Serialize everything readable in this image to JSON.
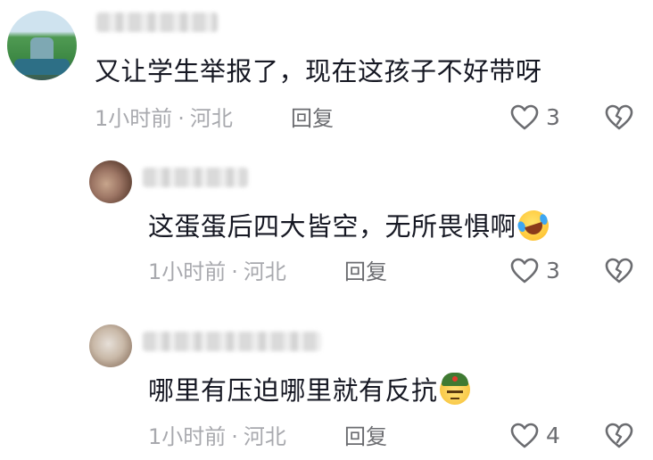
{
  "comments": [
    {
      "text": "又让学生举报了，现在这孩子不好带呀",
      "time": "1小时前",
      "separator": "·",
      "location": "河北",
      "reply_label": "回复",
      "likes": "3"
    },
    {
      "text": "这蛋蛋后四大皆空，无所畏惧啊",
      "emoji": "laughing-tears-emoji",
      "time": "1小时前",
      "separator": "·",
      "location": "河北",
      "reply_label": "回复",
      "likes": "3"
    },
    {
      "text": "哪里有压迫哪里就有反抗",
      "emoji": "soldier-emoji",
      "time": "1小时前",
      "separator": "·",
      "location": "河北",
      "reply_label": "回复",
      "likes": "4"
    }
  ],
  "colors": {
    "text": "#161823",
    "meta": "#a8a9ae",
    "action": "#6b6c70",
    "background": "#ffffff"
  }
}
